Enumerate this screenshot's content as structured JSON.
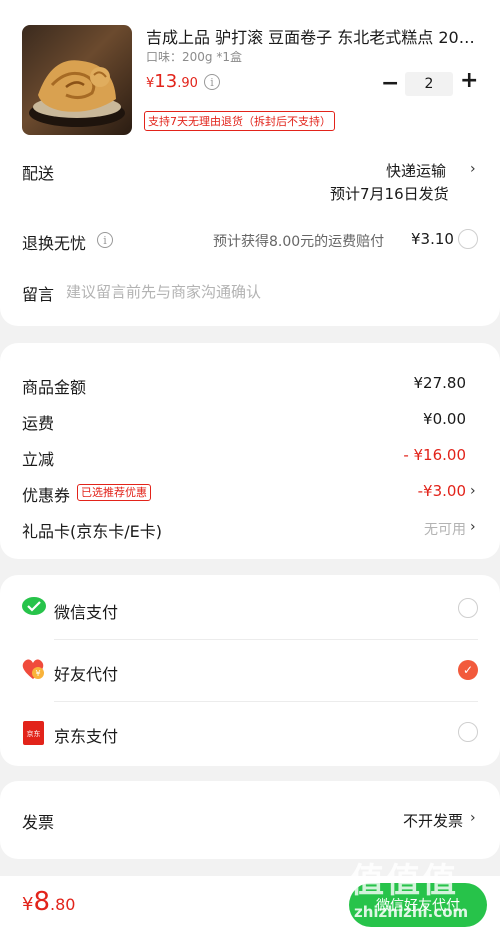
{
  "product": {
    "name": "吉成上品 驴打滚 豆面卷子 东北老式糕点 20…",
    "spec": "口味：200g *1盒",
    "price_currency": "¥",
    "price_int": "13",
    "price_dec": ".90",
    "quantity": "2",
    "minus": "−",
    "plus": "+",
    "return_policy": "支持7天无理由退货（拆封后不支持）"
  },
  "delivery": {
    "label": "配送",
    "method": "快递运输",
    "eta": "预计7月16日发货"
  },
  "refund": {
    "label": "退换无忧",
    "desc": "预计获得8.00元的运费赔付",
    "price": "¥3.10"
  },
  "message": {
    "label": "留言",
    "placeholder": "建议留言前先与商家沟通确认"
  },
  "summary": {
    "goods_label": "商品金额",
    "goods_value": "¥27.80",
    "shipping_label": "运费",
    "shipping_value": "¥0.00",
    "discount_label": "立减",
    "discount_value": "- ¥16.00",
    "coupon_label": "优惠券",
    "coupon_tag": "已选推荐优惠",
    "coupon_value": "-¥3.00",
    "giftcard_label": "礼品卡(京东卡/E卡)",
    "giftcard_value": "无可用"
  },
  "payment": {
    "options": [
      {
        "label": "微信支付",
        "selected": false
      },
      {
        "label": "好友代付",
        "selected": true
      },
      {
        "label": "京东支付",
        "selected": false
      }
    ],
    "jd_icon_text": "京东"
  },
  "invoice": {
    "label": "发票",
    "value": "不开发票"
  },
  "footer": {
    "currency": "¥",
    "total_int": "8",
    "total_dec": ".80",
    "button": "微信好友代付",
    "watermark": "值值值",
    "watermark_site": "zhizhizhi.com"
  },
  "colors": {
    "accent": "#e2231a",
    "pay_button": "#27c34a",
    "selected_radio": "#f25a3c"
  }
}
